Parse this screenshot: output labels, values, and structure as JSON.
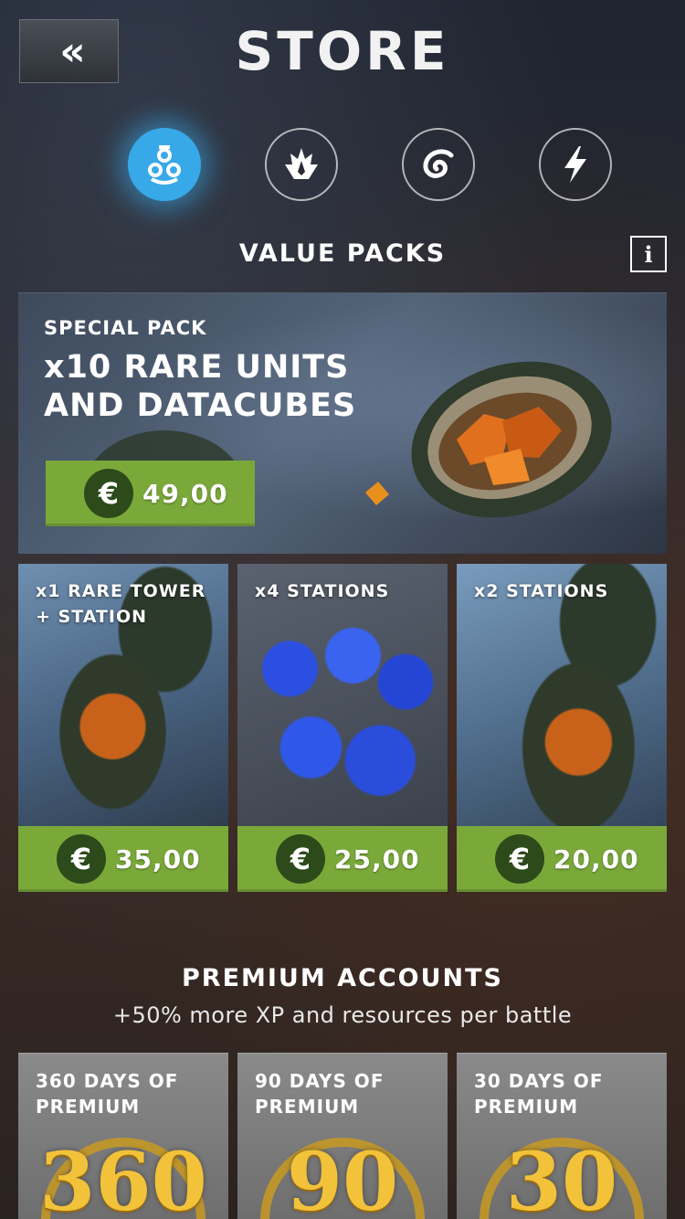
{
  "header": {
    "back_label": "«",
    "title": "STORE"
  },
  "categories": [
    {
      "name": "value-packs",
      "icon": "nuclear-icon",
      "active": true
    },
    {
      "name": "units",
      "icon": "flame-icon",
      "active": false
    },
    {
      "name": "resources",
      "icon": "swirl-icon",
      "active": false
    },
    {
      "name": "boosts",
      "icon": "lightning-icon",
      "active": false
    }
  ],
  "value_packs": {
    "title": "VALUE PACKS",
    "info_label": "i",
    "featured": {
      "kicker": "SPECIAL PACK",
      "headline": "x10 RARE UNITS AND DATACUBES",
      "currency": "€",
      "price": "49,00"
    },
    "packs": [
      {
        "label": "x1 RARE TOWER + STATION",
        "currency": "€",
        "price": "35,00"
      },
      {
        "label": "x4 STATIONS",
        "currency": "€",
        "price": "25,00"
      },
      {
        "label": "x2 STATIONS",
        "currency": "€",
        "price": "20,00"
      }
    ]
  },
  "premium": {
    "title": "PREMIUM ACCOUNTS",
    "subtitle": "+50% more XP and resources per battle",
    "items": [
      {
        "label": "360 DAYS OF PREMIUM",
        "badge": "360"
      },
      {
        "label": "90 DAYS OF PREMIUM",
        "badge": "90"
      },
      {
        "label": "30 DAYS OF PREMIUM",
        "badge": "30"
      }
    ]
  },
  "colors": {
    "accent_blue": "#38a9e8",
    "price_green": "#7aa93a",
    "euro_dark_green": "#2d4a1a",
    "gold": "#f2c23a"
  }
}
